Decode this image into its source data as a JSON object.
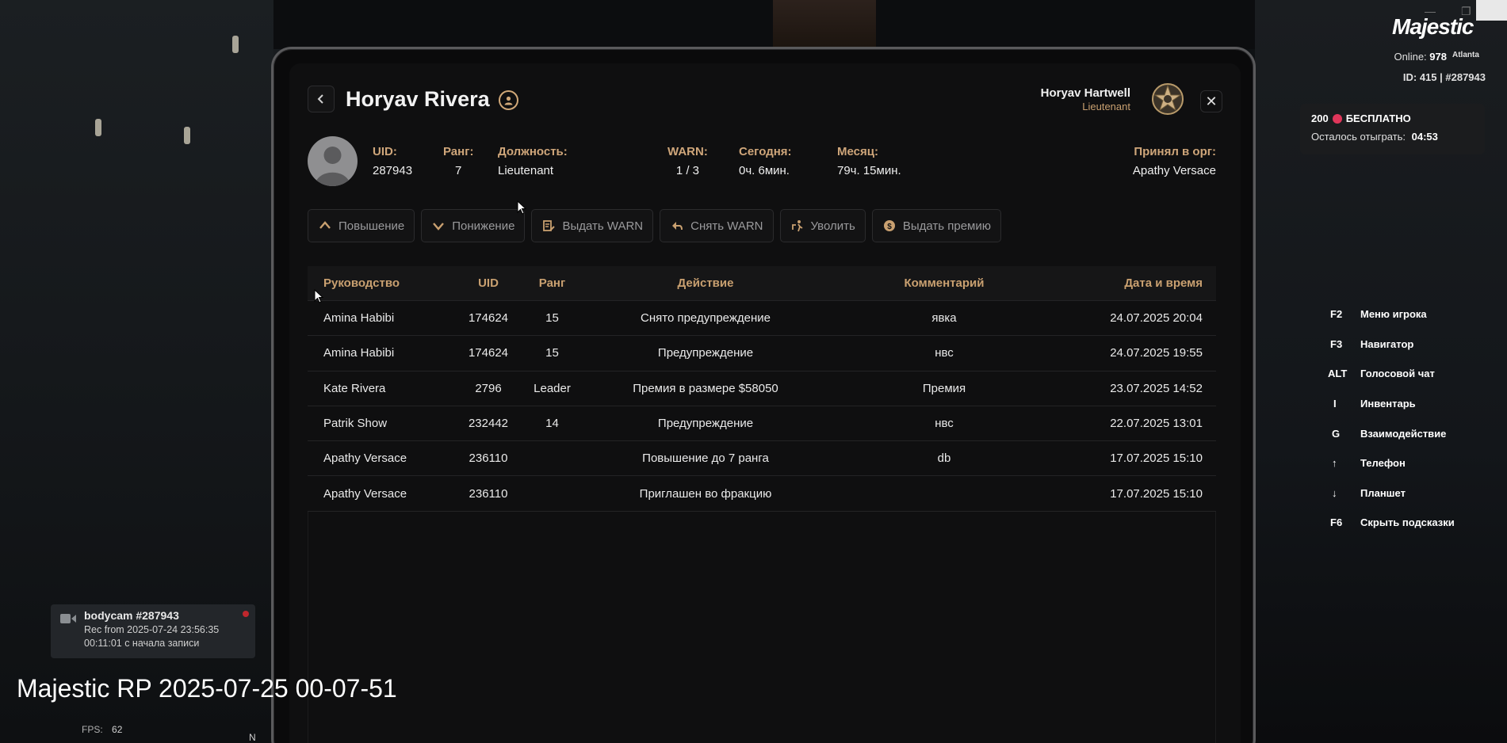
{
  "header": {
    "title": "Horyav Rivera",
    "user_name": "Horyav Hartwell",
    "user_rank": "Lieutenant"
  },
  "profile": {
    "uid_label": "UID:",
    "uid_value": "287943",
    "rank_label": "Ранг:",
    "rank_value": "7",
    "position_label": "Должность:",
    "position_value": "Lieutenant",
    "warn_label": "WARN:",
    "warn_value": "1 / 3",
    "today_label": "Сегодня:",
    "today_value": "0ч. 6мин.",
    "month_label": "Месяц:",
    "month_value": "79ч. 15мин.",
    "accepted_label": "Принял в орг:",
    "accepted_value": "Apathy Versace"
  },
  "actions": [
    {
      "label": "Повышение",
      "icon": "chevron-up-icon"
    },
    {
      "label": "Понижение",
      "icon": "chevron-down-icon"
    },
    {
      "label": "Выдать WARN",
      "icon": "warn-icon"
    },
    {
      "label": "Снять WARN",
      "icon": "undo-icon"
    },
    {
      "label": "Уволить",
      "icon": "fire-icon"
    },
    {
      "label": "Выдать премию",
      "icon": "coin-icon"
    }
  ],
  "table": {
    "headers": [
      "Руководство",
      "UID",
      "Ранг",
      "Действие",
      "Комментарий",
      "Дата и время"
    ],
    "rows": [
      [
        "Amina Habibi",
        "174624",
        "15",
        "Снято предупреждение",
        "явка",
        "24.07.2025 20:04"
      ],
      [
        "Amina Habibi",
        "174624",
        "15",
        "Предупреждение",
        "нвс",
        "24.07.2025 19:55"
      ],
      [
        "Kate Rivera",
        "2796",
        "Leader",
        "Премия в размере $58050",
        "Премия",
        "23.07.2025 14:52"
      ],
      [
        "Patrik Show",
        "232442",
        "14",
        "Предупреждение",
        "нвс",
        "22.07.2025 13:01"
      ],
      [
        "Apathy Versace",
        "236110",
        "",
        "Повышение до 7 ранга",
        "db",
        "17.07.2025 15:10"
      ],
      [
        "Apathy Versace",
        "236110",
        "",
        "Приглашен во фракцию",
        "",
        "17.07.2025 15:10"
      ]
    ]
  },
  "hud": {
    "logo": "Majestic",
    "online_label": "Online:",
    "online_value": "978",
    "server": "Atlanta",
    "id_text": "ID: 415 | #287943",
    "promo_count": "200",
    "promo_text": "БЕСПЛАТНО",
    "promo_remaining_label": "Осталось отыграть:",
    "promo_remaining_value": "04:53",
    "hotkeys": [
      {
        "key": "F2",
        "label": "Меню игрока"
      },
      {
        "key": "F3",
        "label": "Навигатор"
      },
      {
        "key": "ALT",
        "label": "Голосовой чат"
      },
      {
        "key": "I",
        "label": "Инвентарь"
      },
      {
        "key": "G",
        "label": "Взаимодействие"
      },
      {
        "key": "↑",
        "label": "Телефон"
      },
      {
        "key": "↓",
        "label": "Планшет"
      },
      {
        "key": "F6",
        "label": "Скрыть подсказки"
      }
    ]
  },
  "bodycam": {
    "title": "bodycam #287943",
    "line1": "Rec from 2025-07-24 23:56:35",
    "line2": "00:11:01 с начала записи"
  },
  "overlay": {
    "watermark": "Majestic RP 2025-07-25 00-07-51",
    "fps_label": "FPS:",
    "fps_value": "62",
    "compass": "N"
  },
  "colors": {
    "accent": "#c9a070",
    "panel_bg": "#0f0f10",
    "rec": "#c0272d",
    "promo_dot": "#e0365a"
  }
}
